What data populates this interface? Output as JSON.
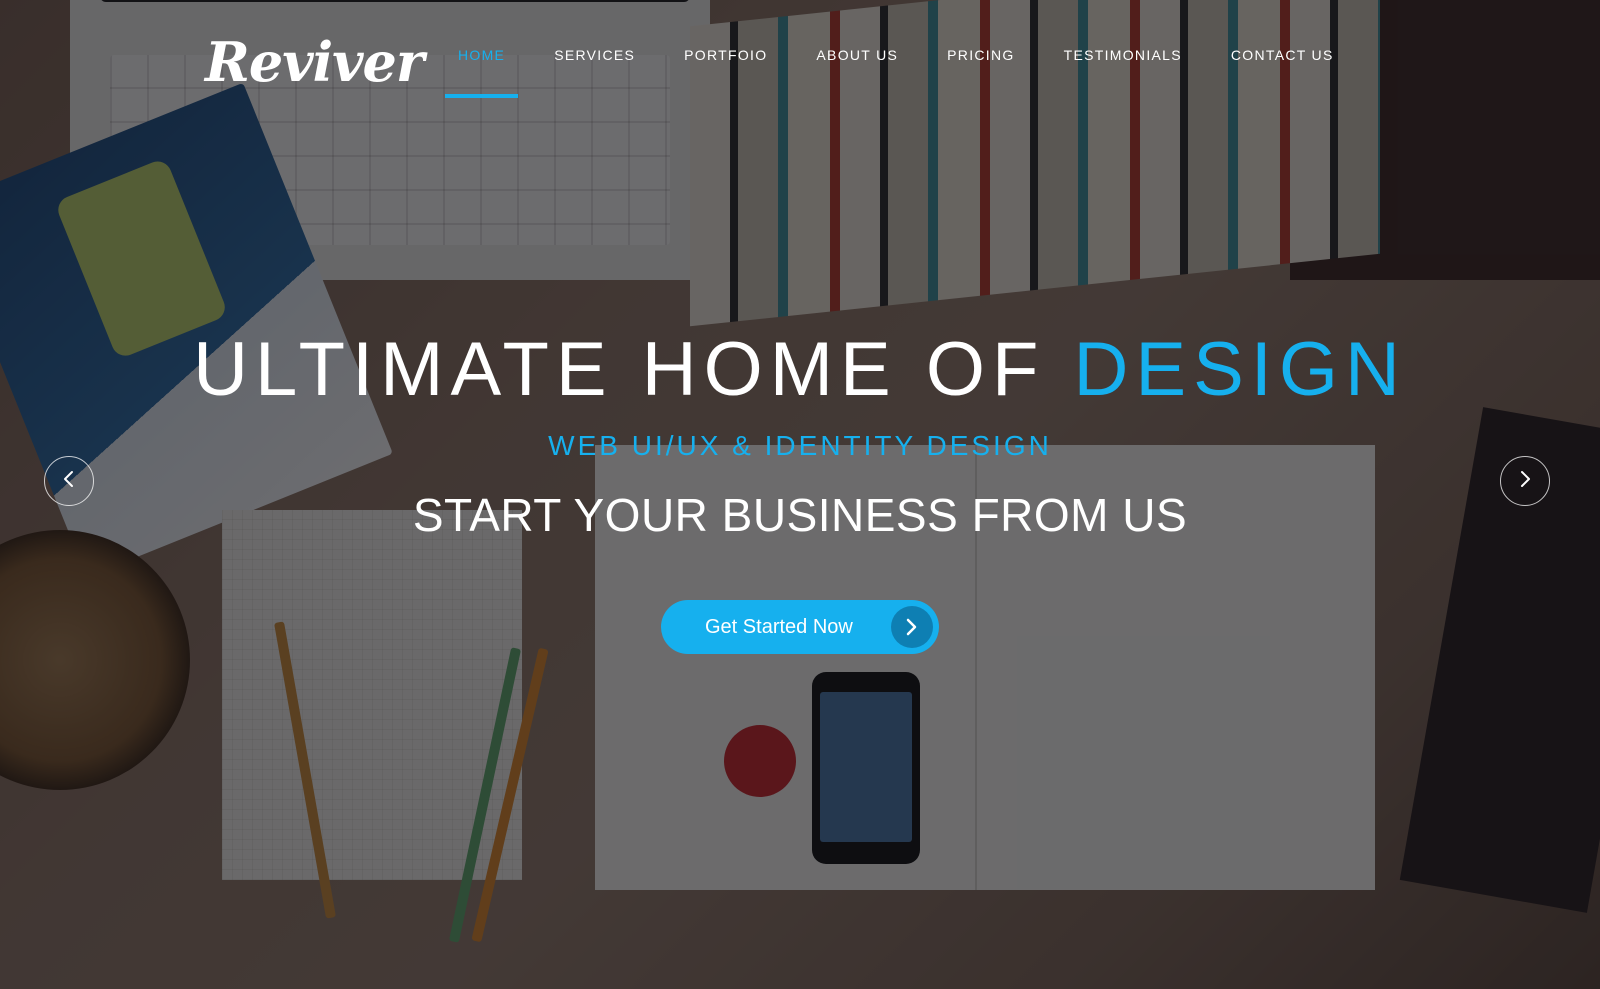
{
  "header": {
    "logo_text": "Reviver",
    "nav": [
      {
        "label": "HOME",
        "active": true
      },
      {
        "label": "SERVICES",
        "active": false
      },
      {
        "label": "PORTFOIO",
        "active": false
      },
      {
        "label": "ABOUT US",
        "active": false
      },
      {
        "label": "PRICING",
        "active": false
      },
      {
        "label": "TESTIMONIALS",
        "active": false
      },
      {
        "label": "CONTACT US",
        "active": false
      }
    ]
  },
  "hero": {
    "headline_main": "ULTIMATE HOME OF ",
    "headline_accent": "DESIGN",
    "subheadline": "WEB UI/UX & IDENTITY DESIGN",
    "tagline": "START YOUR BUSINESS FROM US",
    "cta_label": "Get Started Now",
    "cta_icon": "chevron-right-icon"
  },
  "slider": {
    "prev_icon": "chevron-left-icon",
    "next_icon": "chevron-right-icon"
  },
  "colors": {
    "accent": "#16b0ee",
    "text": "#ffffff",
    "overlay": "rgba(10,10,16,0.58)"
  }
}
